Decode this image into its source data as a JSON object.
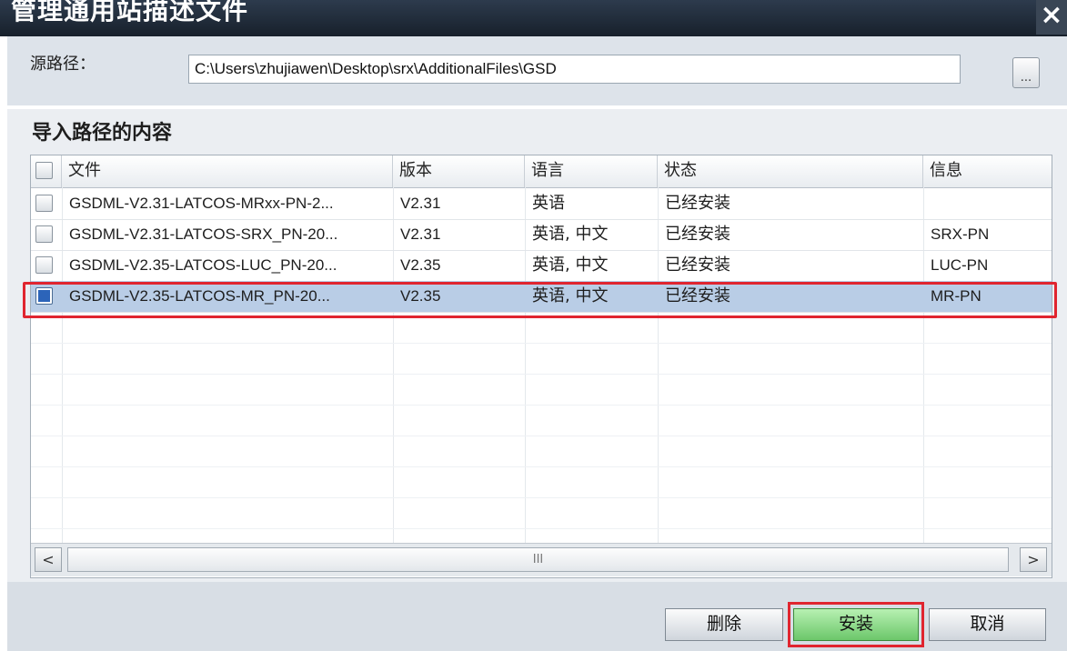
{
  "window": {
    "title": "管理通用站描述文件",
    "close_label": "×"
  },
  "source": {
    "label": "源路径：",
    "path": "C:\\Users\\zhujiawen\\Desktop\\srx\\AdditionalFiles\\GSD",
    "browse_label": "..."
  },
  "content": {
    "title": "导入路径的内容",
    "columns": [
      "文件",
      "版本",
      "语言",
      "状态",
      "信息"
    ],
    "rows": [
      {
        "checked": false,
        "file": "GSDML-V2.31-LATCOS-MRxx-PN-2...",
        "version": "V2.31",
        "language": "英语",
        "status": "已经安装",
        "info": ""
      },
      {
        "checked": false,
        "file": "GSDML-V2.31-LATCOS-SRX_PN-20...",
        "version": "V2.31",
        "language": "英语, 中文",
        "status": "已经安装",
        "info": "SRX-PN"
      },
      {
        "checked": false,
        "file": "GSDML-V2.35-LATCOS-LUC_PN-20...",
        "version": "V2.35",
        "language": "英语, 中文",
        "status": "已经安装",
        "info": "LUC-PN"
      },
      {
        "checked": true,
        "file": "GSDML-V2.35-LATCOS-MR_PN-20...",
        "version": "V2.35",
        "language": "英语, 中文",
        "status": "已经安装",
        "info": "MR-PN"
      }
    ],
    "scrollbar": {
      "left": "<",
      "right": ">",
      "grip": "III"
    }
  },
  "buttons": {
    "delete": "删除",
    "install": "安装",
    "cancel": "取消"
  },
  "colors": {
    "selection": "#b9cde6",
    "highlight_border": "#e0252f",
    "install_button": "#6cc76a",
    "title_bar": "#17202b"
  }
}
